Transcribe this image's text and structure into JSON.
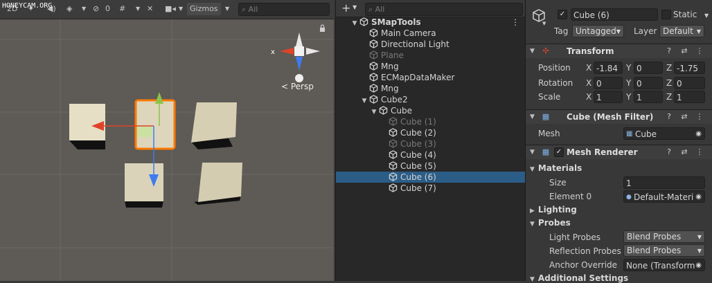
{
  "watermark": "HONEYCAM.ORG",
  "scene": {
    "toolbar": {
      "mode_2d": "2D",
      "hidden_count": "0",
      "gizmos_label": "Gizmos",
      "search_placeholder": "All"
    },
    "gizmo": {
      "x_label": "x",
      "persp_label": "< Persp"
    }
  },
  "hierarchy": {
    "search_placeholder": "All",
    "rows": [
      {
        "label": "SMapTools",
        "indent": 0,
        "arrow": "open",
        "scene": true
      },
      {
        "label": "Main Camera",
        "indent": 1
      },
      {
        "label": "Directional Light",
        "indent": 1
      },
      {
        "label": "Plane",
        "indent": 1,
        "dim": true
      },
      {
        "label": "Mng",
        "indent": 1
      },
      {
        "label": "ECMapDataMaker",
        "indent": 1
      },
      {
        "label": "Mng",
        "indent": 1
      },
      {
        "label": "Cube2",
        "indent": 1,
        "arrow": "open"
      },
      {
        "label": "Cube",
        "indent": 2,
        "arrow": "open"
      },
      {
        "label": "Cube (1)",
        "indent": 3,
        "dim": true
      },
      {
        "label": "Cube (2)",
        "indent": 3
      },
      {
        "label": "Cube (3)",
        "indent": 3,
        "dim": true
      },
      {
        "label": "Cube (4)",
        "indent": 3
      },
      {
        "label": "Cube (5)",
        "indent": 3
      },
      {
        "label": "Cube (6)",
        "indent": 3,
        "selected": true
      },
      {
        "label": "Cube (7)",
        "indent": 3
      }
    ]
  },
  "inspector": {
    "object_name": "Cube (6)",
    "static_label": "Static",
    "tag_label": "Tag",
    "tag_value": "Untagged",
    "layer_label": "Layer",
    "layer_value": "Default",
    "transform": {
      "title": "Transform",
      "position_label": "Position",
      "rotation_label": "Rotation",
      "scale_label": "Scale",
      "x": "X",
      "y": "Y",
      "z": "Z",
      "position": [
        "-1.84",
        "0",
        "-1.75"
      ],
      "rotation": [
        "0",
        "0",
        "0"
      ],
      "scale": [
        "1",
        "1",
        "1"
      ]
    },
    "mesh_filter": {
      "title": "Cube (Mesh Filter)",
      "mesh_label": "Mesh",
      "mesh_value": "Cube"
    },
    "mesh_renderer": {
      "title": "Mesh Renderer",
      "materials_label": "Materials",
      "size_label": "Size",
      "size_value": "1",
      "element0_label": "Element 0",
      "element0_value": "Default-Materi",
      "lighting_label": "Lighting",
      "probes_label": "Probes",
      "light_probes_label": "Light Probes",
      "light_probes_value": "Blend Probes",
      "reflection_probes_label": "Reflection Probes",
      "reflection_probes_value": "Blend Probes",
      "anchor_override_label": "Anchor Override",
      "anchor_override_value": "None (Transform)",
      "additional_settings_label": "Additional Settings"
    }
  },
  "colors": {
    "selection": "#2c5d87",
    "scene_bg": "#5e5a55",
    "cube_face": "#e3dcc4",
    "cube_highlight": "#ff7a00",
    "axis_x": "#e0432a",
    "axis_y": "#8bc34a",
    "axis_z": "#3d7bf0"
  }
}
